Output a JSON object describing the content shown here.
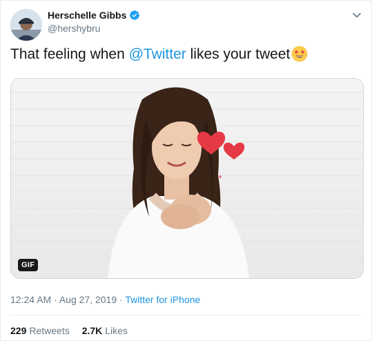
{
  "author": {
    "name": "Herschelle Gibbs",
    "handle": "@hershybru"
  },
  "tweet": {
    "text_prefix": "That feeling when ",
    "mention": "@Twitter",
    "text_suffix": " likes your tweet",
    "emoji": "star-struck-emoji"
  },
  "media": {
    "badge": "GIF"
  },
  "meta": {
    "time": "12:24 AM",
    "separator1": " · ",
    "date": "Aug 27, 2019",
    "separator2": " · ",
    "source": "Twitter for iPhone"
  },
  "stats": {
    "retweets_count": "229",
    "retweets_label": "Retweets",
    "likes_count": "2.7K",
    "likes_label": "Likes"
  },
  "colors": {
    "link": "#1b95e0",
    "secondary_text": "#657786",
    "primary_text": "#14171a",
    "verified": "#1da1f2"
  }
}
